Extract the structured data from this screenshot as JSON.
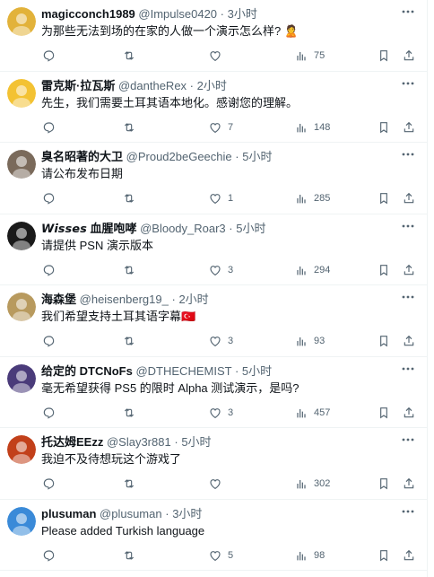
{
  "replies": [
    {
      "name": "magicconch1989",
      "handle": "@Impulse0420",
      "dot": "·",
      "time": "3小时",
      "text": "为那些无法到场的在家的人做一个演示怎么样? ",
      "emoji": "🙎",
      "reply_count": "",
      "retweet_count": "",
      "like_count": "",
      "views": "75",
      "avatar_color": "#e2b23a"
    },
    {
      "name": "雷克斯·拉瓦斯",
      "handle": "@dantheRex",
      "dot": "·",
      "time": "2小时",
      "text": "先生，我们需要土耳其语本地化。感谢您的理解。",
      "emoji": "",
      "reply_count": "",
      "retweet_count": "",
      "like_count": "7",
      "views": "148",
      "avatar_color": "#f3c233"
    },
    {
      "name": "臭名昭著的大卫",
      "handle": "@Proud2beGeechie",
      "dot": "·",
      "time": "5小时",
      "text": "请公布发布日期",
      "emoji": "",
      "reply_count": "",
      "retweet_count": "",
      "like_count": "1",
      "views": "285",
      "avatar_color": "#7a6a5b"
    },
    {
      "name": "𝙒𝙞𝙨𝙨𝙚𝙨 血腥咆哮",
      "handle": "@Bloody_Roar3",
      "dot": "·",
      "time": "5小时",
      "text": "请提供 PSN 演示版本",
      "emoji": "",
      "reply_count": "",
      "retweet_count": "",
      "like_count": "3",
      "views": "294",
      "avatar_color": "#1a1a1a"
    },
    {
      "name": "海森堡",
      "handle": "@heisenberg19_",
      "dot": "·",
      "time": "2小时",
      "text": "我们希望支持土耳其语字幕",
      "emoji": "🇹🇷",
      "reply_count": "",
      "retweet_count": "",
      "like_count": "3",
      "views": "93",
      "avatar_color": "#b89a5e"
    },
    {
      "name": "给定的 DTCNoFs",
      "handle": "@DTHECHEMIST",
      "dot": "·",
      "time": "5小时",
      "text": "毫无希望获得 PS5 的限时 Alpha 测试演示，是吗?",
      "emoji": "",
      "reply_count": "",
      "retweet_count": "",
      "like_count": "3",
      "views": "457",
      "avatar_color": "#4a3b7a"
    },
    {
      "name": "托达姆EEzz",
      "handle": "@Slay3r881",
      "dot": "·",
      "time": "5小时",
      "text": "我迫不及待想玩这个游戏了",
      "emoji": "",
      "reply_count": "",
      "retweet_count": "",
      "like_count": "",
      "views": "302",
      "avatar_color": "#c2401a"
    },
    {
      "name": "plusuman",
      "handle": "@plusuman",
      "dot": "·",
      "time": "3小时",
      "text": "Please added Turkish language",
      "emoji": "",
      "reply_count": "",
      "retweet_count": "",
      "like_count": "5",
      "views": "98",
      "avatar_color": "#3a8ad8"
    }
  ],
  "icons": {
    "reply": "reply-icon",
    "retweet": "retweet-icon",
    "like": "heart-icon",
    "views": "views-icon",
    "bookmark": "bookmark-icon",
    "share": "share-icon",
    "more": "more-icon"
  },
  "colors": {
    "text": "#0f1419",
    "muted": "#536471",
    "border": "#eff3f4"
  }
}
